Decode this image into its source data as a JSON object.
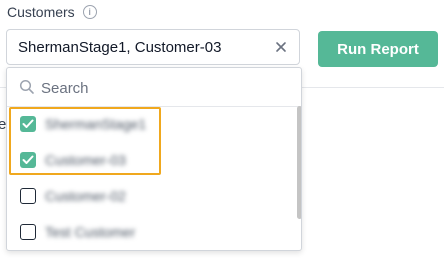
{
  "filter": {
    "label": "Customers",
    "info_icon": "i",
    "selected_value": "ShermanStage1, Customer-03"
  },
  "run_report": {
    "label": "Run Report"
  },
  "background": {
    "edge_text": "e"
  },
  "dropdown": {
    "search_placeholder": "Search",
    "options": [
      {
        "label": "ShermanStage1",
        "checked": true
      },
      {
        "label": "Customer-03",
        "checked": true
      },
      {
        "label": "Customer-02",
        "checked": false
      },
      {
        "label": "Test Customer",
        "checked": false
      }
    ]
  },
  "colors": {
    "accent": "#55b897",
    "highlight": "#f0a81e"
  }
}
